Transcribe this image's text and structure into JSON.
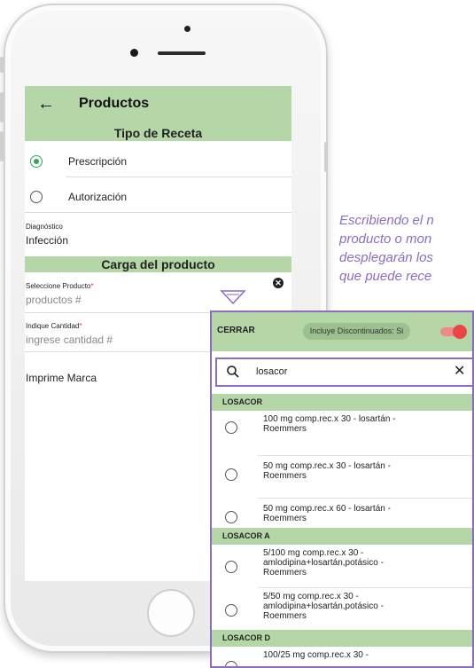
{
  "header": {
    "title": "Productos"
  },
  "recipe_type": {
    "title": "Tipo de Receta",
    "options": [
      "Prescripción",
      "Autorización"
    ],
    "selected": 0
  },
  "diagnosis": {
    "label": "Diagnóstico",
    "value": "Infección"
  },
  "product_load": {
    "title": "Carga del producto"
  },
  "product_field": {
    "label": "Seleccione Producto",
    "required": "*",
    "placeholder": "productos #"
  },
  "quantity_field": {
    "label": "Indique Cantidad",
    "required": "*",
    "placeholder": "ingrese cantidad #"
  },
  "print_brand": {
    "label": "Imprime Marca"
  },
  "caption": {
    "lines": [
      "Escribiendo el n",
      "producto o mon",
      "desplegarán los",
      "que puede rece"
    ]
  },
  "popup": {
    "close_label": "CERRAR",
    "discontinued_chip": "Incluye Discontinuados: Si",
    "search_value": "losacor",
    "groups": [
      {
        "name": "LOSACOR",
        "items": [
          [
            "100 mg comp.rec.x 30 - losartán -",
            "Roemmers"
          ],
          [
            "50 mg comp.rec.x 30 - losartán -",
            "Roemmers"
          ],
          [
            "50 mg comp.rec.x 60 - losartán -",
            "Roemmers"
          ]
        ]
      },
      {
        "name": "LOSACOR A",
        "items": [
          [
            "5/100 mg comp.rec.x 30 -",
            "amlodipina+losartán,potásico -",
            "Roemmers"
          ],
          [
            "5/50 mg comp.rec.x 30 -",
            "amlodipina+losartán,potásico -",
            "Roemmers"
          ]
        ]
      },
      {
        "name": "LOSACOR D",
        "items": [
          [
            "100/25 mg comp.rec.x 30 -"
          ]
        ]
      }
    ]
  },
  "colors": {
    "accent_green": "#b5d7a8",
    "highlight_purple": "#8a6dc2",
    "toggle_red": "#e84545"
  }
}
